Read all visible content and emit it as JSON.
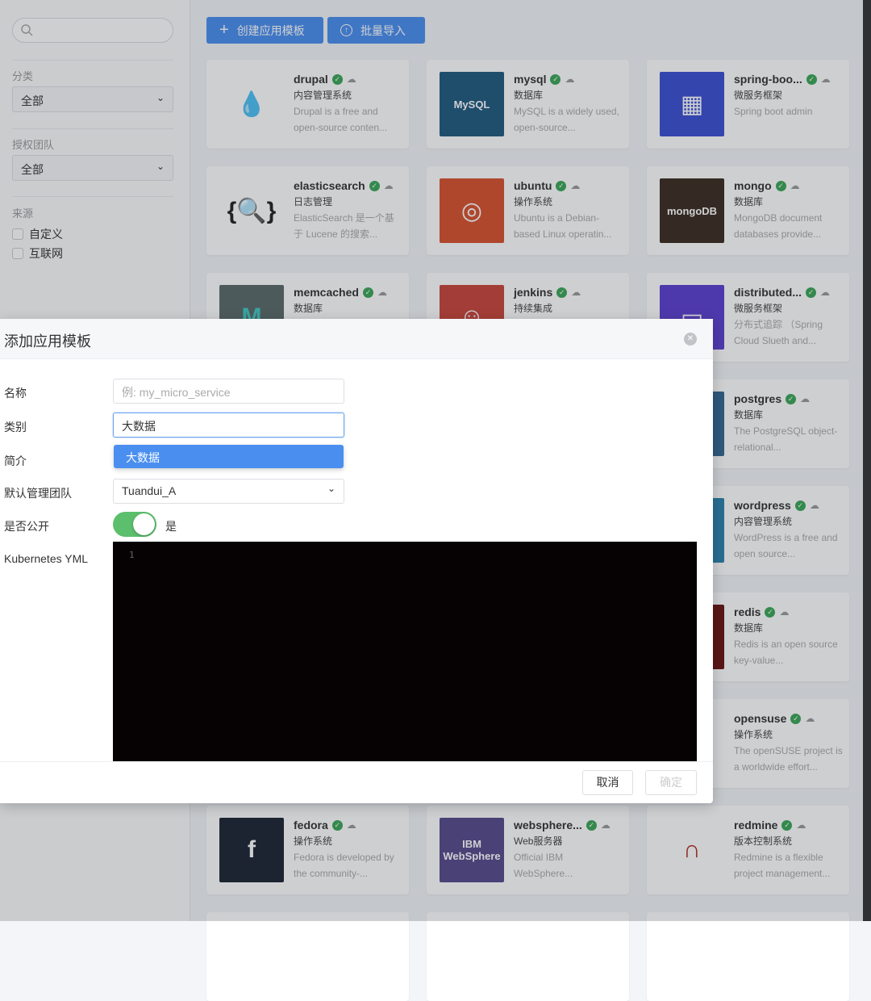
{
  "sidebar": {
    "search_placeholder": "",
    "category_label": "分类",
    "category_value": "全部",
    "team_label": "授权团队",
    "team_value": "全部",
    "source_label": "来源",
    "sources": [
      {
        "label": "自定义",
        "checked": false
      },
      {
        "label": "互联网",
        "checked": false
      }
    ]
  },
  "toolbar": {
    "create_label": "创建应用模板",
    "import_label": "批量导入",
    "accent": "#4a8ff0"
  },
  "cards": [
    {
      "name": "drupal",
      "category": "内容管理系统",
      "desc": "Drupal is a free and open-source conten...",
      "logo_text": "💧",
      "logo_bg": "#ffffff",
      "logo_fg": "#2a6fad"
    },
    {
      "name": "mysql",
      "category": "数据库",
      "desc": "MySQL is a widely used, open-source...",
      "logo_text": "MySQL",
      "logo_bg": "#1f5a7e",
      "logo_fg": "#ffffff"
    },
    {
      "name": "spring-boo...",
      "category": "微服务框架",
      "desc": "Spring boot admin",
      "logo_text": "▦",
      "logo_bg": "#3a4fd2",
      "logo_fg": "#ffffff"
    },
    {
      "name": "elasticsearch",
      "category": "日志管理",
      "desc": "ElasticSearch 是一个基于 Lucene 的搜索...",
      "logo_text": "{🔍}",
      "logo_bg": "#ffffff",
      "logo_fg": "#222222"
    },
    {
      "name": "ubuntu",
      "category": "操作系统",
      "desc": "Ubuntu is a Debian-based Linux operatin...",
      "logo_text": "◎",
      "logo_bg": "#d8512e",
      "logo_fg": "#ffffff"
    },
    {
      "name": "mongo",
      "category": "数据库",
      "desc": "MongoDB document databases provide...",
      "logo_text": "mongoDB",
      "logo_bg": "#3a2c20",
      "logo_fg": "#ffffff"
    },
    {
      "name": "memcached",
      "category": "数据库",
      "desc": "",
      "logo_text": "M",
      "logo_bg": "#5a6a6a",
      "logo_fg": "#40c8c0"
    },
    {
      "name": "jenkins",
      "category": "持续集成",
      "desc": "",
      "logo_text": "☺",
      "logo_bg": "#c8453a",
      "logo_fg": "#ffffff"
    },
    {
      "name": "distributed...",
      "category": "微服务框架",
      "desc": "分布式追踪 （Spring Cloud Slueth and...",
      "logo_text": "▭",
      "logo_bg": "#5c3fd0",
      "logo_fg": "#ffffff"
    },
    {
      "name": "postgres",
      "category": "数据库",
      "desc": "The PostgreSQL object-relational...",
      "logo_text": "",
      "logo_bg": "#336791",
      "logo_fg": "#ffffff"
    },
    {
      "name": "wordpress",
      "category": "内容管理系统",
      "desc": "WordPress is a free and open source...",
      "logo_text": "",
      "logo_bg": "#2a83ad",
      "logo_fg": "#ffffff"
    },
    {
      "name": "redis",
      "category": "数据库",
      "desc": "Redis is an open source key-value...",
      "logo_text": "",
      "logo_bg": "#6a1410",
      "logo_fg": "#ffffff"
    },
    {
      "name": "opensuse",
      "category": "操作系统",
      "desc": "The openSUSE project is a worldwide effort...",
      "logo_text": "",
      "logo_bg": "#ffffff",
      "logo_fg": "#73ba25"
    },
    {
      "name": "fedora",
      "category": "操作系统",
      "desc": "Fedora is developed by the community-...",
      "logo_text": "f",
      "logo_bg": "#1d2533",
      "logo_fg": "#ffffff"
    },
    {
      "name": "websphere...",
      "category": "Web服务器",
      "desc": "Official IBM WebSphere...",
      "logo_text": "IBM WebSphere",
      "logo_bg": "#574a8c",
      "logo_fg": "#ffffff"
    },
    {
      "name": "redmine",
      "category": "版本控制系统",
      "desc": "Redmine is a flexible project management...",
      "logo_text": "∩",
      "logo_bg": "#ffffff",
      "logo_fg": "#b0281c"
    }
  ],
  "modal": {
    "title": "添加应用模板",
    "fields": {
      "name_label": "名称",
      "name_placeholder": "例: my_micro_service",
      "category_label": "类别",
      "category_value": "大数据",
      "category_option": "大数据",
      "intro_label": "简介",
      "team_label": "默认管理团队",
      "team_value": "Tuandui_A",
      "public_label": "是否公开",
      "public_on": true,
      "public_text": "是",
      "yml_label": "Kubernetes YML",
      "yml_line": "1"
    },
    "cancel_label": "取消",
    "confirm_label": "确定"
  }
}
